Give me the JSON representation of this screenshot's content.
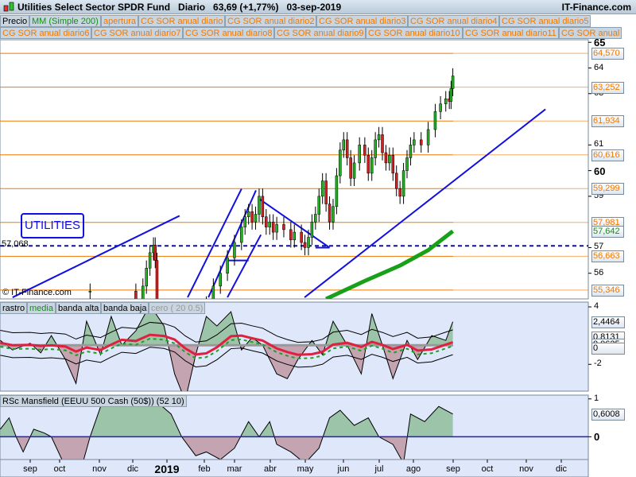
{
  "header": {
    "title": "Utilities Select Sector SPDR Fund   Diario   63,69 (+1,77%)   03-sep-2019",
    "site": "IT-Finance.com"
  },
  "legend_row1": [
    "Precio",
    "MM (Simple 200)",
    "apertura",
    "CG SOR anual diario",
    "CG SOR anual diario2",
    "CG SOR anual diario3",
    "CG SOR anual diario4",
    "CG SOR anual diario5"
  ],
  "legend_row2": [
    "CG SOR anual diario6",
    "CG SOR anual diario7",
    "CG SOR anual diario8",
    "CG SOR anual diario9",
    "CG SOR anual diario10",
    "CG SOR anual diario11",
    "CG SOR anual"
  ],
  "label_box": "UTILITIES",
  "dashed_label": "57,068",
  "copyright": "© IT-Finance.com",
  "colors": {
    "orange": "#f07800",
    "blue": "#1010e0",
    "ma": "#18a018",
    "pos": "#9cc4a8",
    "neg": "#c4a4b0"
  },
  "chart_data": [
    {
      "type": "candlestick",
      "title": "Precio",
      "ylim": [
        55,
        65.1
      ],
      "yticks": [
        {
          "v": 65,
          "l": "65",
          "b": true
        },
        {
          "v": 64,
          "l": "64"
        },
        {
          "v": 63,
          "l": "63"
        },
        {
          "v": 61,
          "l": "61"
        },
        {
          "v": 60,
          "l": "60",
          "b": true
        },
        {
          "v": 59,
          "l": "59"
        },
        {
          "v": 57,
          "l": "57"
        },
        {
          "v": 56,
          "l": "56"
        }
      ],
      "levels": [
        {
          "v": 64.57,
          "l": "64,570"
        },
        {
          "v": 63.252,
          "l": "63,252"
        },
        {
          "v": 61.934,
          "l": "61,934"
        },
        {
          "v": 60.616,
          "l": "60,616"
        },
        {
          "v": 59.299,
          "l": "59,299"
        },
        {
          "v": 57.981,
          "l": "57,981"
        },
        {
          "v": 56.663,
          "l": "56,663"
        },
        {
          "v": 55.346,
          "l": "55,346"
        }
      ],
      "ma200_last": {
        "v": 57.642,
        "l": "57,642"
      },
      "ma200": [
        [
          8.4,
          55.0
        ],
        [
          9.5,
          55.7
        ],
        [
          10.5,
          56.3
        ],
        [
          11.3,
          56.9
        ],
        [
          12,
          57.64
        ]
      ],
      "dashed_level": 57.068,
      "trendlines": [
        [
          -0.5,
          55.06,
          4.24,
          58.24
        ],
        [
          4.47,
          55.06,
          6.0,
          59.29
        ],
        [
          5.06,
          55.06,
          6.41,
          59.23
        ],
        [
          5.6,
          55.06,
          6.55,
          57.5
        ],
        [
          6.5,
          58.9,
          8.5,
          57.0
        ],
        [
          8.1,
          57.0,
          8.5,
          57.0
        ],
        [
          7.79,
          55.06,
          14.63,
          62.39
        ],
        [
          5.6,
          56.5,
          6.2,
          56.5
        ]
      ],
      "closes": [
        [
          1.7,
          55.3
        ],
        [
          3.0,
          54.8
        ],
        [
          3.2,
          55.5
        ],
        [
          3.3,
          56.2
        ],
        [
          3.4,
          56.8
        ],
        [
          3.5,
          57.1
        ],
        [
          3.55,
          56.5
        ],
        [
          3.6,
          54.5
        ],
        [
          5.0,
          54.8
        ],
        [
          5.2,
          55.5
        ],
        [
          5.4,
          56
        ],
        [
          5.6,
          56.6
        ],
        [
          5.8,
          57.2
        ],
        [
          6.0,
          57.8
        ],
        [
          6.1,
          58.2
        ],
        [
          6.2,
          58.4
        ],
        [
          6.3,
          58.0
        ],
        [
          6.4,
          58.3
        ],
        [
          6.5,
          59.0
        ],
        [
          6.6,
          58.2
        ],
        [
          6.7,
          57.8
        ],
        [
          6.8,
          58.0
        ],
        [
          6.9,
          57.6
        ],
        [
          7.0,
          57.9
        ],
        [
          7.2,
          57.7
        ],
        [
          7.4,
          57.3
        ],
        [
          7.5,
          57.6
        ],
        [
          7.7,
          57.2
        ],
        [
          7.8,
          57.0
        ],
        [
          7.9,
          57.4
        ],
        [
          8.0,
          58.0
        ],
        [
          8.1,
          58.3
        ],
        [
          8.2,
          59.0
        ],
        [
          8.3,
          59.6
        ],
        [
          8.4,
          58.7
        ],
        [
          8.5,
          58.0
        ],
        [
          8.6,
          58.6
        ],
        [
          8.7,
          59.8
        ],
        [
          8.8,
          60.8
        ],
        [
          8.9,
          61.2
        ],
        [
          9.0,
          60.5
        ],
        [
          9.1,
          59.7
        ],
        [
          9.2,
          60.3
        ],
        [
          9.35,
          61.0
        ],
        [
          9.5,
          60.6
        ],
        [
          9.6,
          59.9
        ],
        [
          9.7,
          60.5
        ],
        [
          9.8,
          61.2
        ],
        [
          9.9,
          61.4
        ],
        [
          10.0,
          60.7
        ],
        [
          10.1,
          60.3
        ],
        [
          10.2,
          60.6
        ],
        [
          10.3,
          59.9
        ],
        [
          10.4,
          59.3
        ],
        [
          10.5,
          59.0
        ],
        [
          10.6,
          60.0
        ],
        [
          10.7,
          60.5
        ],
        [
          10.8,
          61.0
        ],
        [
          10.9,
          61.2
        ],
        [
          11.1,
          61.0
        ],
        [
          11.3,
          61.6
        ],
        [
          11.5,
          62.3
        ],
        [
          11.65,
          62.6
        ],
        [
          11.8,
          62.8
        ],
        [
          11.9,
          62.7
        ],
        [
          11.95,
          63.2
        ],
        [
          12.0,
          63.69
        ]
      ],
      "months": [
        "sep",
        "oct",
        "nov",
        "dic",
        "2019",
        "feb",
        "mar",
        "abr",
        "may",
        "jun",
        "jul",
        "ago",
        "sep",
        "oct",
        "nov",
        "dic"
      ]
    },
    {
      "type": "area",
      "title": "rastro",
      "legend": [
        "rastro",
        "media",
        "banda alta",
        "banda baja",
        "cero ( 20 0.5)"
      ],
      "ylim": [
        -4.8,
        4.5
      ],
      "yticks": [
        {
          "v": 4,
          "l": "4"
        },
        {
          "v": -2,
          "l": "-2"
        }
      ],
      "tags": [
        {
          "v": 2.4464,
          "l": "2,4464"
        },
        {
          "v": 0.8131,
          "l": "0,8131"
        },
        {
          "v": 0.0625,
          "l": "0,0625"
        },
        {
          "v": -0.35,
          "l": "0"
        }
      ],
      "values": [
        [
          -0.85,
          0.5
        ],
        [
          -0.5,
          -0.5
        ],
        [
          0,
          0.2
        ],
        [
          0.3,
          -0.8
        ],
        [
          0.6,
          1
        ],
        [
          1,
          -1.5
        ],
        [
          1.3,
          -4
        ],
        [
          1.6,
          2.5
        ],
        [
          2,
          -1
        ],
        [
          2.3,
          3
        ],
        [
          2.6,
          0
        ],
        [
          3,
          1.5
        ],
        [
          3.4,
          4.2
        ],
        [
          3.8,
          2
        ],
        [
          4.1,
          -3
        ],
        [
          4.4,
          -5.8
        ],
        [
          4.7,
          -1
        ],
        [
          5,
          3
        ],
        [
          5.3,
          2
        ],
        [
          5.7,
          3.5
        ],
        [
          6,
          -0.5
        ],
        [
          6.3,
          0.8
        ],
        [
          6.6,
          0
        ],
        [
          7,
          -3
        ],
        [
          7.3,
          -3.5
        ],
        [
          7.6,
          -1.5
        ],
        [
          8,
          0.5
        ],
        [
          8.3,
          -1
        ],
        [
          8.6,
          2.5
        ],
        [
          9,
          0
        ],
        [
          9.4,
          -3
        ],
        [
          9.7,
          3.3
        ],
        [
          10,
          0
        ],
        [
          10.3,
          -3.5
        ],
        [
          10.7,
          0.5
        ],
        [
          11,
          -1.5
        ],
        [
          11.4,
          1
        ],
        [
          11.8,
          0.5
        ],
        [
          12,
          2.45
        ]
      ]
    },
    {
      "type": "area",
      "title": "RSc Mansfield (EEUU 500 Cash (50$)) (52 10)",
      "ylim": [
        -0.6,
        1.1
      ],
      "yticks": [
        {
          "v": 1,
          "l": "1"
        },
        {
          "v": 0,
          "l": "0",
          "b": true
        }
      ],
      "tags": [
        {
          "v": 0.6008,
          "l": "0,6008"
        }
      ],
      "values": [
        [
          -0.85,
          0.2
        ],
        [
          -0.6,
          0.5
        ],
        [
          -0.4,
          0
        ],
        [
          -0.2,
          -0.4
        ],
        [
          0.1,
          0.2
        ],
        [
          0.4,
          0.1
        ],
        [
          0.6,
          0
        ],
        [
          1,
          -0.8
        ],
        [
          1.4,
          -1.0
        ],
        [
          1.7,
          0
        ],
        [
          2,
          0.8
        ],
        [
          2.4,
          1.2
        ],
        [
          2.8,
          0.8
        ],
        [
          3.2,
          1.3
        ],
        [
          3.5,
          1.0
        ],
        [
          4,
          0.6
        ],
        [
          4.3,
          0
        ],
        [
          4.7,
          -0.5
        ],
        [
          5,
          -0.4
        ],
        [
          5.4,
          -0.6
        ],
        [
          5.8,
          -0.3
        ],
        [
          6.2,
          0.4
        ],
        [
          6.5,
          0
        ],
        [
          6.8,
          0.4
        ],
        [
          7,
          -0.2
        ],
        [
          7.4,
          -0.4
        ],
        [
          7.8,
          -0.7
        ],
        [
          8.2,
          -0.3
        ],
        [
          8.5,
          0.5
        ],
        [
          8.8,
          0.7
        ],
        [
          9.2,
          0.3
        ],
        [
          9.6,
          0.5
        ],
        [
          9.9,
          0
        ],
        [
          10.3,
          -0.2
        ],
        [
          10.6,
          -0.7
        ],
        [
          10.8,
          0.6
        ],
        [
          11.2,
          0.4
        ],
        [
          11.6,
          0.8
        ],
        [
          12,
          0.6
        ]
      ]
    }
  ]
}
